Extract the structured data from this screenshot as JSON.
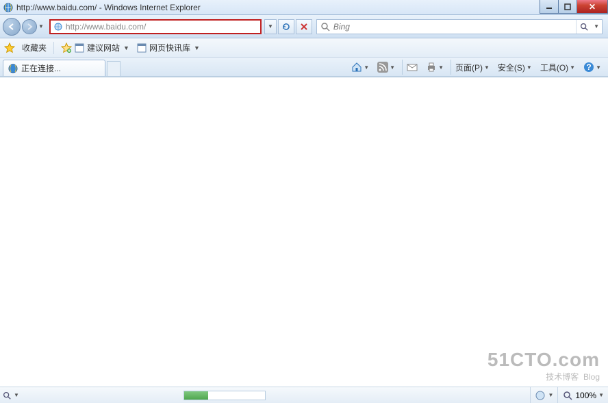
{
  "window": {
    "title": "http://www.baidu.com/ - Windows Internet Explorer"
  },
  "nav": {
    "url": "http://www.baidu.com/",
    "search_placeholder": "Bing"
  },
  "favbar": {
    "label": "收藏夹",
    "suggested": "建议网站",
    "slice": "网页快讯库"
  },
  "tab": {
    "title": "正在连接..."
  },
  "cmd": {
    "page": "页面(P)",
    "safety": "安全(S)",
    "tools": "工具(O)"
  },
  "status": {
    "zoom": "100%"
  },
  "watermark": {
    "line1": "51CTO.com",
    "line2": "技术博客",
    "line3": "Blog"
  }
}
